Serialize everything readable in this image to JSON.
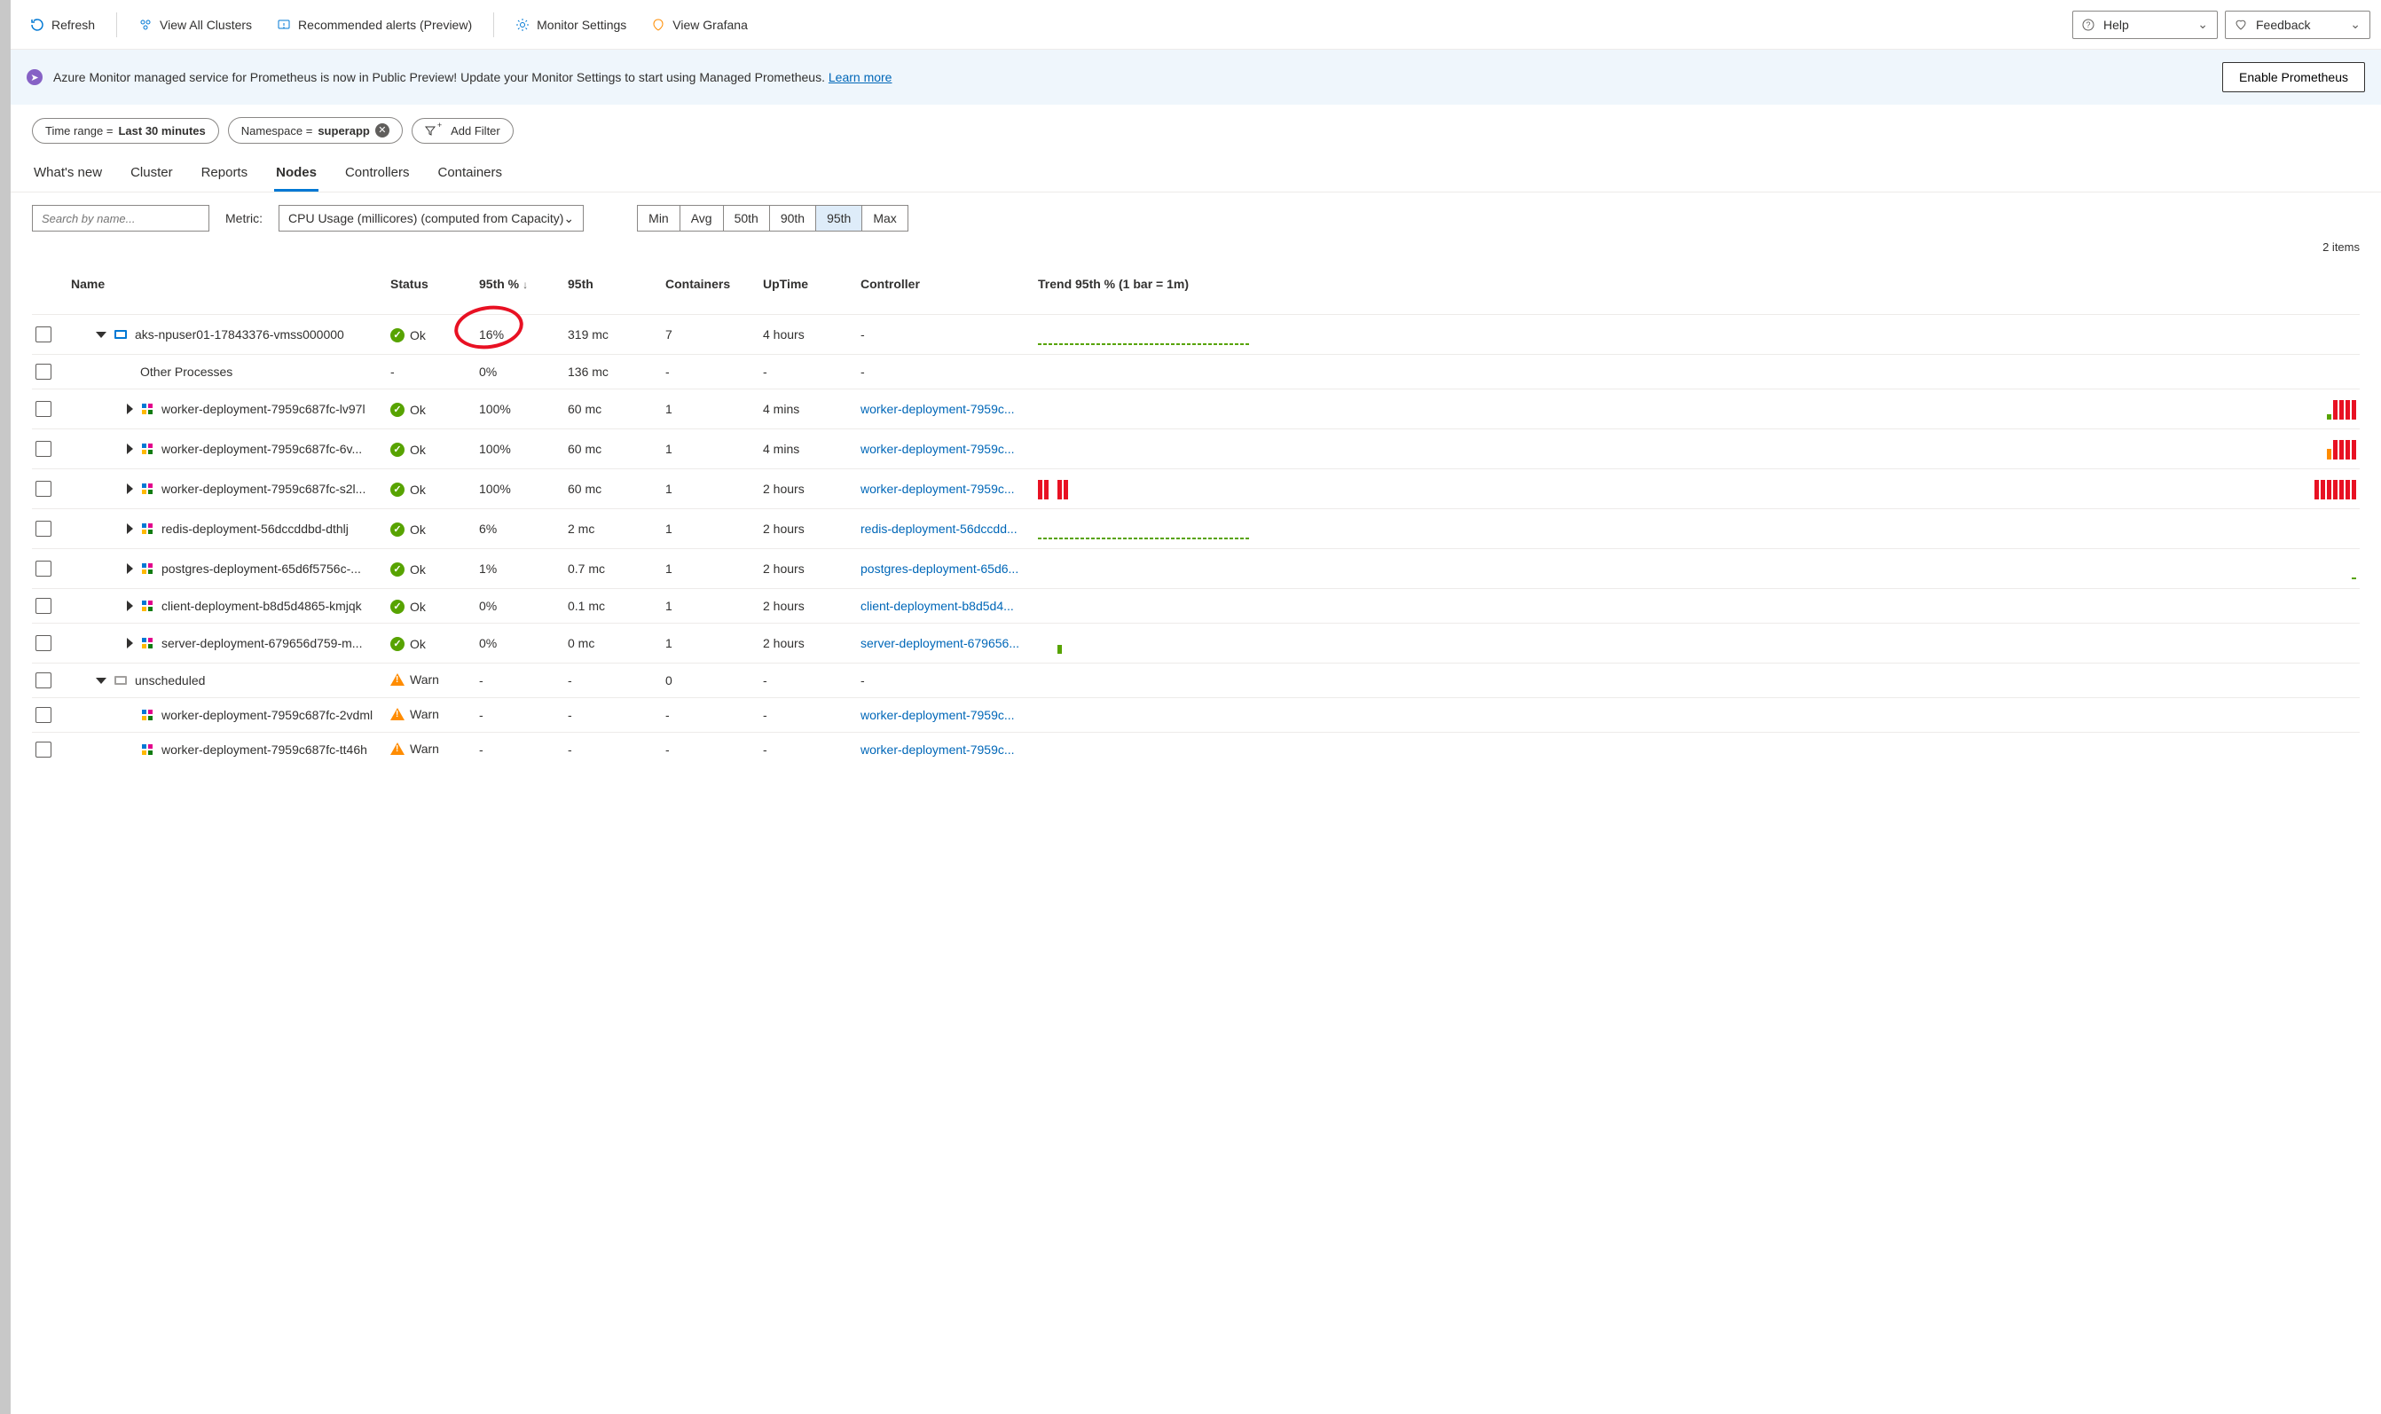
{
  "toolbar": {
    "refresh": "Refresh",
    "view_clusters": "View All Clusters",
    "rec_alerts": "Recommended alerts (Preview)",
    "monitor_settings": "Monitor Settings",
    "view_grafana": "View Grafana",
    "help": "Help",
    "feedback": "Feedback"
  },
  "banner": {
    "text": "Azure Monitor managed service for Prometheus is now in Public Preview! Update your Monitor Settings to start using Managed Prometheus.",
    "link_label": "Learn more",
    "button_label": "Enable Prometheus"
  },
  "filters": {
    "time_range_label": "Time range = ",
    "time_range_value": "Last 30 minutes",
    "namespace_label": "Namespace = ",
    "namespace_value": "superapp",
    "add_filter": "Add Filter"
  },
  "tabs": [
    "What's new",
    "Cluster",
    "Reports",
    "Nodes",
    "Controllers",
    "Containers"
  ],
  "active_tab": "Nodes",
  "search": {
    "placeholder": "Search by name..."
  },
  "metric": {
    "label": "Metric:",
    "value": "CPU Usage (millicores) (computed from Capacity)"
  },
  "segments": [
    "Min",
    "Avg",
    "50th",
    "90th",
    "95th",
    "Max"
  ],
  "active_segment": "95th",
  "items_count": "2 items",
  "columns": {
    "name": "Name",
    "status": "Status",
    "p95pct": "95th %",
    "p95": "95th",
    "containers": "Containers",
    "uptime": "UpTime",
    "controller": "Controller",
    "trend": "Trend 95th % (1 bar = 1m)"
  },
  "rows": [
    {
      "kind": "node",
      "expand": "down",
      "indent": 0,
      "icon": "node",
      "name": "aks-npuser01-17843376-vmss000000",
      "status": "Ok",
      "p95pct": "16%",
      "p95": "319 mc",
      "containers": "7",
      "uptime": "4 hours",
      "controller": "-",
      "circle": true,
      "spark": "green-dashes"
    },
    {
      "kind": "other",
      "indent": 1,
      "icon": "none",
      "name": "Other Processes",
      "status": "-",
      "p95pct": "0%",
      "p95": "136 mc",
      "containers": "-",
      "uptime": "-",
      "controller": "-",
      "spark": "none"
    },
    {
      "kind": "pod",
      "expand": "right",
      "indent": 1,
      "icon": "pod",
      "name": "worker-deployment-7959c687fc-lv97l",
      "status": "Ok",
      "p95pct": "100%",
      "p95": "60 mc",
      "containers": "1",
      "uptime": "4 mins",
      "controller": "worker-deployment-7959c...",
      "spark": "red-right-a"
    },
    {
      "kind": "pod",
      "expand": "right",
      "indent": 1,
      "icon": "pod",
      "name": "worker-deployment-7959c687fc-6v...",
      "status": "Ok",
      "p95pct": "100%",
      "p95": "60 mc",
      "containers": "1",
      "uptime": "4 mins",
      "controller": "worker-deployment-7959c...",
      "spark": "red-right-b"
    },
    {
      "kind": "pod",
      "expand": "right",
      "indent": 1,
      "icon": "pod",
      "name": "worker-deployment-7959c687fc-s2l...",
      "status": "Ok",
      "p95pct": "100%",
      "p95": "60 mc",
      "containers": "1",
      "uptime": "2 hours",
      "controller": "worker-deployment-7959c...",
      "spark": "red-both"
    },
    {
      "kind": "pod",
      "expand": "right",
      "indent": 1,
      "icon": "pod",
      "name": "redis-deployment-56dccddbd-dthlj",
      "status": "Ok",
      "p95pct": "6%",
      "p95": "2 mc",
      "containers": "1",
      "uptime": "2 hours",
      "controller": "redis-deployment-56dccdd...",
      "spark": "green-dashes"
    },
    {
      "kind": "pod",
      "expand": "right",
      "indent": 1,
      "icon": "pod",
      "name": "postgres-deployment-65d6f5756c-...",
      "status": "Ok",
      "p95pct": "1%",
      "p95": "0.7 mc",
      "containers": "1",
      "uptime": "2 hours",
      "controller": "postgres-deployment-65d6...",
      "spark": "tiny-right"
    },
    {
      "kind": "pod",
      "expand": "right",
      "indent": 1,
      "icon": "pod",
      "name": "client-deployment-b8d5d4865-kmjqk",
      "status": "Ok",
      "p95pct": "0%",
      "p95": "0.1 mc",
      "containers": "1",
      "uptime": "2 hours",
      "controller": "client-deployment-b8d5d4...",
      "spark": "none"
    },
    {
      "kind": "pod",
      "expand": "right",
      "indent": 1,
      "icon": "pod",
      "name": "server-deployment-679656d759-m...",
      "status": "Ok",
      "p95pct": "0%",
      "p95": "0 mc",
      "containers": "1",
      "uptime": "2 hours",
      "controller": "server-deployment-679656...",
      "spark": "one-green"
    },
    {
      "kind": "node",
      "expand": "down",
      "indent": 0,
      "icon": "grey",
      "name": "unscheduled",
      "status": "Warn",
      "p95pct": "-",
      "p95": "-",
      "containers": "0",
      "uptime": "-",
      "controller": "-",
      "spark": "none"
    },
    {
      "kind": "pod",
      "indent": 1,
      "icon": "pod",
      "name": "worker-deployment-7959c687fc-2vdml",
      "status": "Warn",
      "p95pct": "-",
      "p95": "-",
      "containers": "-",
      "uptime": "-",
      "controller": "worker-deployment-7959c...",
      "spark": "none"
    },
    {
      "kind": "pod",
      "indent": 1,
      "icon": "pod",
      "name": "worker-deployment-7959c687fc-tt46h",
      "status": "Warn",
      "p95pct": "-",
      "p95": "-",
      "containers": "-",
      "uptime": "-",
      "controller": "worker-deployment-7959c...",
      "spark": "none"
    }
  ]
}
